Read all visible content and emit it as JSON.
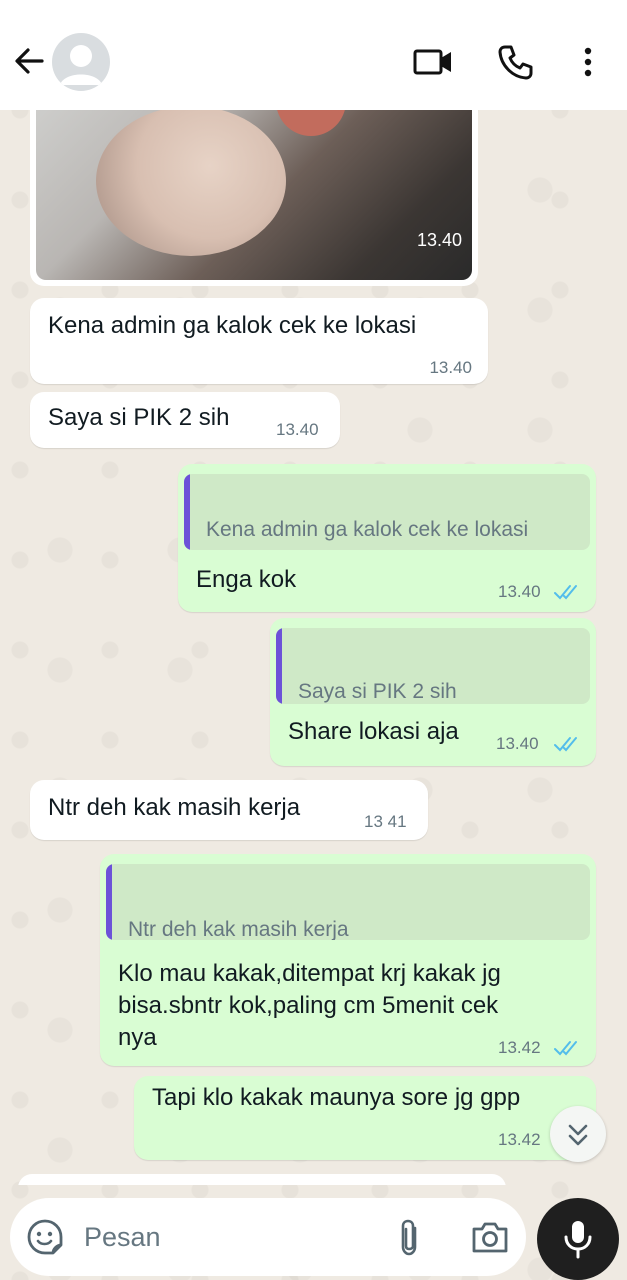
{
  "header": {
    "back_icon": "arrow-left",
    "video_icon": "video-camera",
    "call_icon": "phone",
    "menu_icon": "more-vertical"
  },
  "messages": [
    {
      "type": "image",
      "direction": "in",
      "time": "13.40"
    },
    {
      "type": "text",
      "direction": "in",
      "text": "Kena admin ga kalok cek ke lokasi",
      "time": "13.40"
    },
    {
      "type": "text",
      "direction": "in",
      "text": "Saya si PIK 2 sih",
      "time": "13.40"
    },
    {
      "type": "reply",
      "direction": "out",
      "quote": "Kena admin ga kalok cek ke lokasi",
      "text": "Enga kok",
      "time": "13.40",
      "status": "read"
    },
    {
      "type": "reply",
      "direction": "out",
      "quote": "Saya si PIK 2 sih",
      "text": "Share lokasi aja",
      "time": "13.40",
      "status": "read"
    },
    {
      "type": "text",
      "direction": "in",
      "text": "Ntr deh kak masih kerja",
      "time": "13 41"
    },
    {
      "type": "reply",
      "direction": "out",
      "quote": "Ntr deh kak masih kerja",
      "text": "Klo mau kakak,ditempat krj kakak jg\nbisa.sbntr kok,paling cm 5menit cek\nnya",
      "time": "13.42",
      "status": "read"
    },
    {
      "type": "text",
      "direction": "out",
      "text": "Tapi klo kakak maunya sore jg gpp",
      "time": "13.42"
    }
  ],
  "input": {
    "placeholder": "Pesan",
    "emoji_icon": "sticker-smile",
    "attach_icon": "paperclip",
    "camera_icon": "camera",
    "mic_icon": "microphone"
  },
  "colors": {
    "incoming": "#ffffff",
    "outgoing": "#d9fdd3",
    "quote_bar": "#6c52d8",
    "read_ticks": "#53bdeb",
    "chat_bg": "#efeae2"
  }
}
